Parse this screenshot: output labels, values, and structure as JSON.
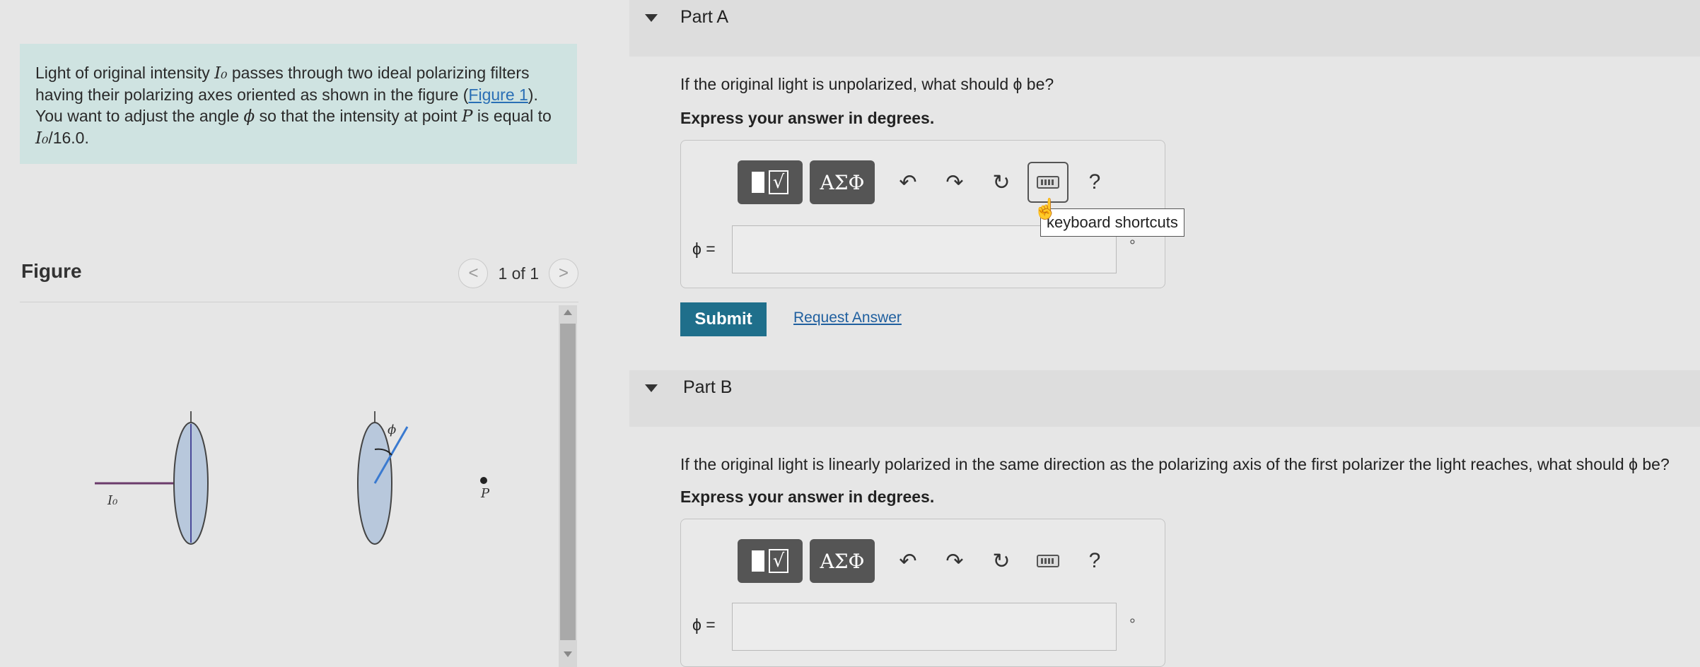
{
  "problem": {
    "text_1": "Light of original intensity ",
    "var_I0": "I₀",
    "text_2": " passes through two ideal polarizing filters having their polarizing axes oriented as shown in the figure (",
    "figure_link": "Figure 1",
    "text_3": "). You want to adjust the angle ",
    "var_phi": "ϕ",
    "text_4": " so that the intensity at point ",
    "var_P": "P",
    "text_5": " is equal to ",
    "var_I0_b": "I₀",
    "text_6": "/16.0."
  },
  "figure": {
    "title": "Figure",
    "pager": "1 of 1",
    "prev": "<",
    "next": ">",
    "labels": {
      "I0": "I₀",
      "phi": "ϕ",
      "P": "P"
    }
  },
  "partA": {
    "title": "Part A",
    "question": "If the original light is unpolarized, what should ϕ be?",
    "instruction": "Express your answer in degrees.",
    "answer_label": "ϕ =",
    "unit": "°",
    "tooltip": "keyboard shortcuts",
    "submit": "Submit",
    "request": "Request Answer"
  },
  "partB": {
    "title": "Part B",
    "question": "If the original light is linearly polarized in the same direction as the polarizing axis of the first polarizer the light reaches, what should ϕ be?",
    "instruction": "Express your answer in degrees.",
    "answer_label": "ϕ =",
    "unit": "°"
  },
  "toolbar": {
    "greek": "ΑΣΦ",
    "radical": "√",
    "undo": "↶",
    "redo": "↷",
    "reset": "↻",
    "help": "?"
  },
  "icons": {
    "undo": "undo-icon",
    "redo": "redo-icon",
    "reset": "reset-icon",
    "keyboard": "keyboard-icon",
    "help": "help-icon"
  }
}
